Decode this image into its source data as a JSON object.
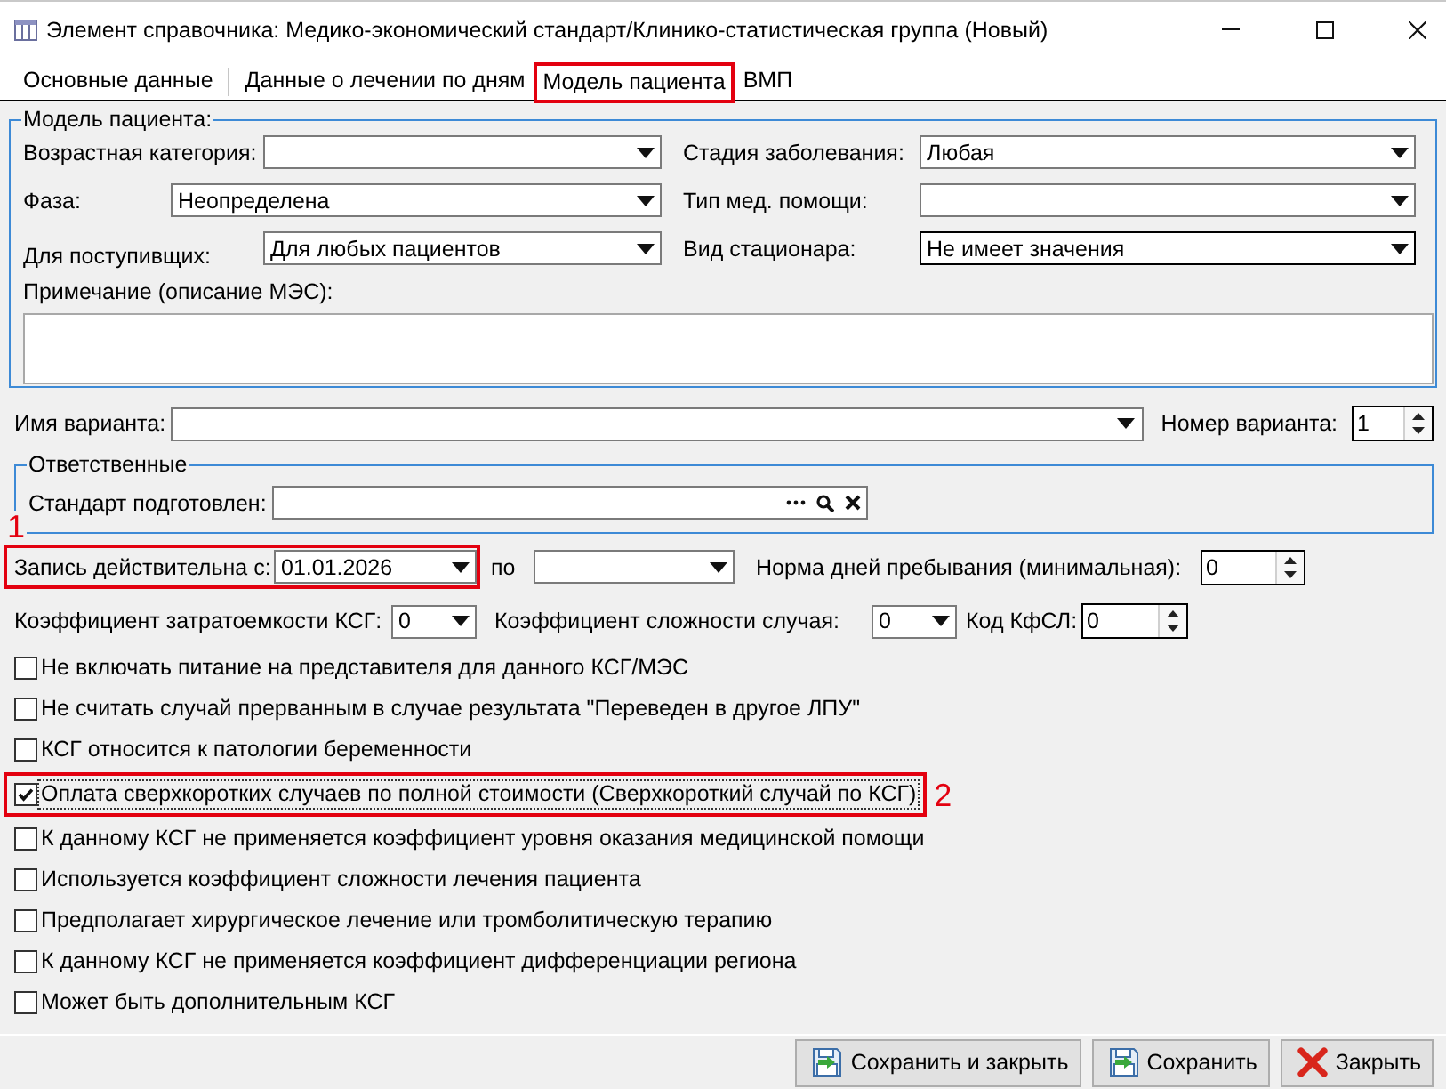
{
  "window": {
    "title": "Элемент справочника: Медико-экономический стандарт/Клинико-статистическая группа (Новый)"
  },
  "tabs": [
    {
      "label": "Основные данные",
      "selected": false,
      "highlighted": false
    },
    {
      "label": "Данные о лечении по дням",
      "selected": false,
      "highlighted": false
    },
    {
      "label": "Модель пациента",
      "selected": true,
      "highlighted": true
    },
    {
      "label": "ВМП",
      "selected": false,
      "highlighted": false
    }
  ],
  "patient_model": {
    "legend": "Модель пациента:",
    "rows": [
      [
        {
          "label": "Возрастная категория:",
          "focused": false
        },
        {
          "label": "Стадия заболевания:",
          "value": "Любая",
          "focused": false
        }
      ],
      [
        {
          "label": "Фаза:",
          "value": "Неопределена",
          "focused": false
        },
        {
          "label": "Тип мед. помощи:",
          "focused": false
        }
      ],
      [
        {
          "label": "Для поступивщих:",
          "value": "Для любых пациентов",
          "focused": false
        },
        {
          "label": "Вид стационара:",
          "value": "Не имеет значения",
          "focused": true
        }
      ]
    ],
    "note": {
      "label": "Примечание (описание МЭС):"
    }
  },
  "variant": {
    "name_label": "Имя варианта:",
    "number_label": "Номер варианта:",
    "number": "1"
  },
  "responsible": {
    "legend": "Ответственные",
    "prepared_by_label": "Стандарт подготовлен:"
  },
  "validity": {
    "from_label": "Запись действительна с:",
    "from": "01.01.2026",
    "highlighted": true,
    "marker": "1",
    "to_label": "по",
    "min_stay_label": "Норма дней пребывания (минимальная):",
    "min_stay": "0"
  },
  "coefficients": [
    {
      "kind": "dropdown",
      "label": "Коэффициент затратоемкости КСГ:",
      "value": "0"
    },
    {
      "kind": "dropdown",
      "label": "Коэффициент сложности случая:",
      "value": "0"
    },
    {
      "kind": "spinner",
      "label": "Код КфСЛ:",
      "value": "0"
    }
  ],
  "options": [
    {
      "label": "Не включать питание на представителя для данного КСГ/МЭС",
      "checked": false,
      "focused": false,
      "highlighted": false
    },
    {
      "label": "Не считать случай прерванным в случае результата \"Переведен в другое ЛПУ\"",
      "checked": false,
      "focused": false,
      "highlighted": false
    },
    {
      "label": "КСГ относится к патологии беременности",
      "checked": false,
      "focused": false,
      "highlighted": false
    },
    {
      "label": "Оплата сверхкоротких случаев по полной стоимости (Сверхкороткий случай по КСГ)",
      "checked": true,
      "focused": true,
      "highlighted": true,
      "marker": "2"
    },
    {
      "label": "К данному КСГ не применяется коэффициент уровня оказания медицинской помощи",
      "checked": false,
      "focused": false,
      "highlighted": false
    },
    {
      "label": "Используется коэффициент сложности лечения пациента",
      "checked": false,
      "focused": false,
      "highlighted": false
    },
    {
      "label": "Предполагает хирургическое лечение или тромболитическую терапию",
      "checked": false,
      "focused": false,
      "highlighted": false
    },
    {
      "label": "К данному КСГ не применяется коэффициент дифференциации региона",
      "checked": false,
      "focused": false,
      "highlighted": false
    },
    {
      "label": "Может быть дополнительным КСГ",
      "checked": false,
      "focused": false,
      "highlighted": false
    }
  ],
  "buttons": [
    {
      "kind": "save_close",
      "label": "Сохранить и закрыть"
    },
    {
      "kind": "save",
      "label": "Сохранить"
    },
    {
      "kind": "close",
      "label": "Закрыть"
    }
  ]
}
